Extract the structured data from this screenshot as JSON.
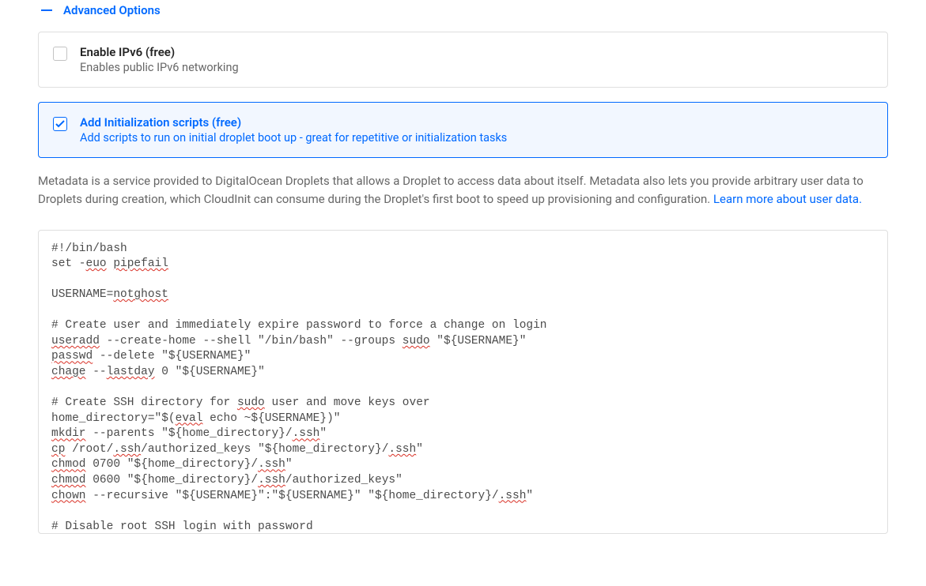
{
  "header": {
    "toggle_label": "Advanced Options"
  },
  "options": {
    "ipv6": {
      "title": "Enable IPv6 (free)",
      "subtitle": "Enables public IPv6 networking",
      "checked": false
    },
    "init_scripts": {
      "title": "Add Initialization scripts (free)",
      "subtitle": "Add scripts to run on initial droplet boot up - great for repetitive or initialization tasks",
      "checked": true
    }
  },
  "metadata": {
    "desc_part1": "Metadata is a service provided to DigitalOcean Droplets that allows a Droplet to access data about itself. Metadata also lets you provide arbitrary user data to Droplets during creation, which CloudInit can consume during the Droplet's first boot to speed up provisioning and configuration. ",
    "link_text": "Learn more about user data.",
    "link_href": "#"
  },
  "script": {
    "l01a": "#!/bin/bash",
    "l02a": "set -",
    "l02b": "euo",
    "l02c": " ",
    "l02d": "pipefail",
    "l03": "",
    "l04a": "USERNAME=",
    "l04b": "notghost",
    "l05": "",
    "l06": "# Create user and immediately expire password to force a change on login",
    "l07a": "useradd",
    "l07b": " --create-home --shell \"/bin/bash\" --groups ",
    "l07c": "sudo",
    "l07d": " \"${USERNAME}\"",
    "l08a": "passwd",
    "l08b": " --delete \"${USERNAME}\"",
    "l09a": "chage",
    "l09b": " --",
    "l09c": "lastday",
    "l09d": " 0 \"${USERNAME}\"",
    "l10": "",
    "l11a": "# Create SSH directory for ",
    "l11b": "sudo",
    "l11c": " user and move keys over",
    "l12a": "home_directory=\"$(",
    "l12b": "eval",
    "l12c": " echo ~${USERNAME})\"",
    "l13a": "mkdir",
    "l13b": " --parents \"${home_directory}/",
    "l13c": ".ssh",
    "l13d": "\"",
    "l14a": "cp",
    "l14b": " /root/",
    "l14c": ".ssh",
    "l14d": "/authorized_keys \"${home_directory}/",
    "l14e": ".ssh",
    "l14f": "\"",
    "l15a": "chmod",
    "l15b": " 0700 \"${home_directory}/",
    "l15c": ".ssh",
    "l15d": "\"",
    "l16a": "chmod",
    "l16b": " 0600 \"${home_directory}/",
    "l16c": ".ssh",
    "l16d": "/authorized_keys\"",
    "l17a": "chown",
    "l17b": " --recursive \"${USERNAME}\":\"${USERNAME}\" \"${home_directory}/",
    "l17c": ".ssh",
    "l17d": "\"",
    "l18": "",
    "l19": "# Disable root SSH login with password"
  }
}
